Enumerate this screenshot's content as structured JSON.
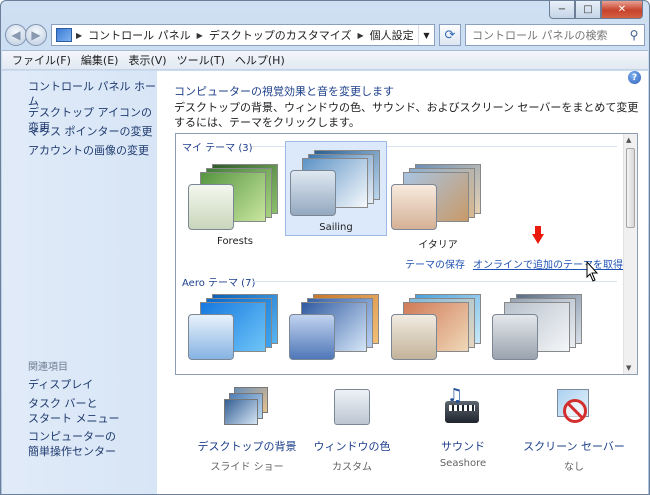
{
  "window": {
    "caption_min": "−",
    "caption_max": "□",
    "caption_close": "✕"
  },
  "address": {
    "crumbs": [
      "コントロール パネル",
      "デスクトップのカスタマイズ",
      "個人設定"
    ],
    "search_placeholder": "コントロール パネルの検索"
  },
  "menu": [
    "ファイル(F)",
    "編集(E)",
    "表示(V)",
    "ツール(T)",
    "ヘルプ(H)"
  ],
  "sidebar": {
    "home": "コントロール パネル ホーム",
    "links": [
      "デスクトップ アイコンの変更",
      "マウス ポインターの変更",
      "アカウントの画像の変更"
    ],
    "related_heading": "関連項目",
    "related": [
      "ディスプレイ",
      "タスク バーと\nスタート メニュー",
      "コンピューターの\n簡単操作センター"
    ]
  },
  "main": {
    "title": "コンピューターの視覚効果と音を変更します",
    "description": "デスクトップの背景、ウィンドウの色、サウンド、およびスクリーン セーバーをまとめて変更するには、テーマをクリックします。",
    "my_themes_heading": "マイ テーマ (3)",
    "my_themes": [
      {
        "name": "Forests",
        "selected": false,
        "accent": "#5f9a3c"
      },
      {
        "name": "Sailing",
        "selected": true,
        "accent": "#6f9ec9"
      },
      {
        "name": "イタリア",
        "selected": false,
        "accent": "#c98e5f"
      }
    ],
    "save_theme_link": "テーマの保存",
    "online_link": "オンラインで追加のテーマを取得",
    "aero_heading": "Aero テーマ (7)",
    "aero_themes": [
      {
        "accent": "#1e7fd6"
      },
      {
        "accent": "#4f7fb8"
      },
      {
        "accent": "#c7b08a"
      },
      {
        "accent": "#9fa7b2"
      }
    ]
  },
  "bottom": [
    {
      "label": "デスクトップの背景",
      "sub": "スライド ショー",
      "icon": "desktop-background-icon"
    },
    {
      "label": "ウィンドウの色",
      "sub": "カスタム",
      "icon": "window-color-icon"
    },
    {
      "label": "サウンド",
      "sub": "Seashore",
      "icon": "sound-icon"
    },
    {
      "label": "スクリーン セーバー",
      "sub": "なし",
      "icon": "screen-saver-icon"
    }
  ],
  "colors": {
    "link": "#1c3f8a",
    "accent_arrow": "#e81b0e",
    "selected_bg": "#dbe9fb"
  }
}
